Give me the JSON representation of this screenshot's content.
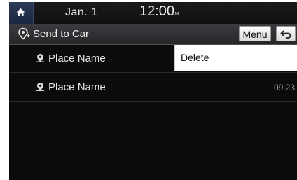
{
  "status_bar": {
    "date": "Jan.  1",
    "time": "12:00",
    "ampm": "AM"
  },
  "header": {
    "title": "Send to Car",
    "menu_label": "Menu"
  },
  "places": [
    {
      "name": "Place Name",
      "time": ""
    },
    {
      "name": "Place Name",
      "time": "09.23"
    }
  ],
  "popup_menu": {
    "items": [
      "Delete"
    ]
  }
}
